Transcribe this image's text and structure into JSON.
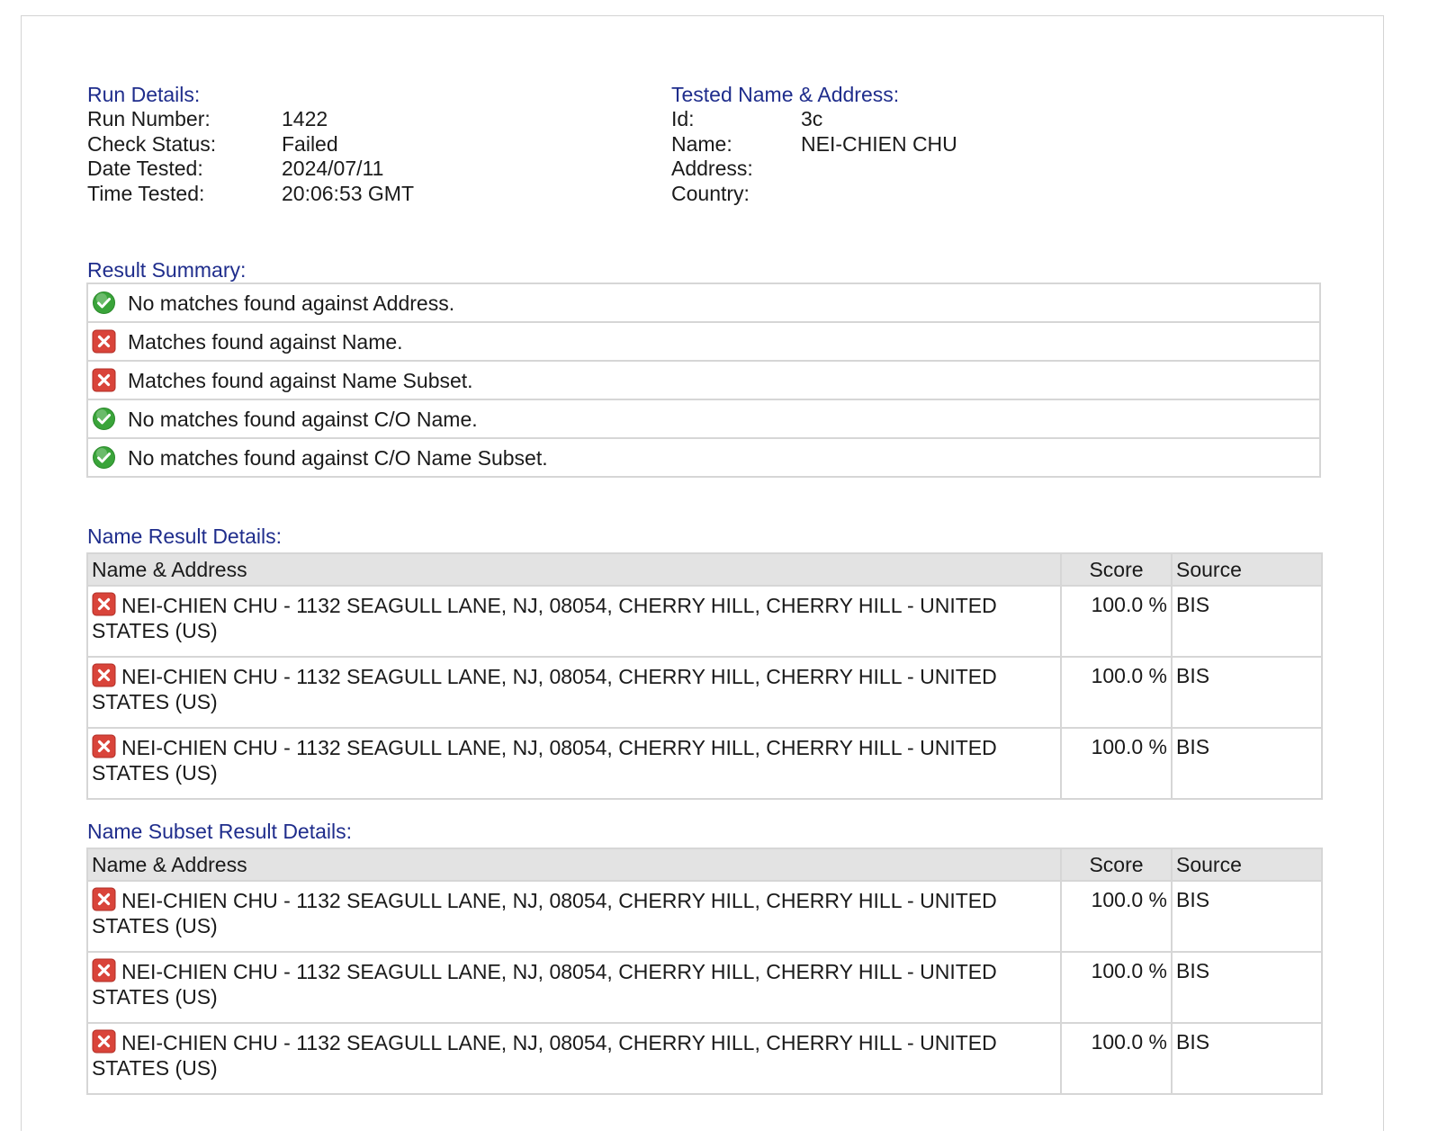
{
  "run_details": {
    "title": "Run Details:",
    "fields": [
      {
        "label": "Run Number:",
        "value": "1422"
      },
      {
        "label": "Check Status:",
        "value": "Failed"
      },
      {
        "label": "Date Tested:",
        "value": "2024/07/11"
      },
      {
        "label": "Time Tested:",
        "value": "20:06:53 GMT"
      }
    ]
  },
  "tested": {
    "title": "Tested Name & Address:",
    "fields": [
      {
        "label": "Id:",
        "value": "3c"
      },
      {
        "label": "Name:",
        "value": "NEI-CHIEN CHU"
      },
      {
        "label": "Address:",
        "value": ""
      },
      {
        "label": "Country:",
        "value": ""
      }
    ]
  },
  "summary": {
    "title": "Result Summary:",
    "rows": [
      {
        "status": "pass",
        "icon": "check-circle-icon",
        "text": "No matches found against Address."
      },
      {
        "status": "fail",
        "icon": "x-square-icon",
        "text": "Matches found against Name."
      },
      {
        "status": "fail",
        "icon": "x-square-icon",
        "text": "Matches found against Name Subset."
      },
      {
        "status": "pass",
        "icon": "check-circle-icon",
        "text": "No matches found against C/O Name."
      },
      {
        "status": "pass",
        "icon": "check-circle-icon",
        "text": "No matches found against C/O Name Subset."
      }
    ]
  },
  "name_results": {
    "title": "Name Result Details:",
    "headers": {
      "name": "Name & Address",
      "score": "Score",
      "source": "Source"
    },
    "rows": [
      {
        "icon": "x-square-icon",
        "name": "NEI-CHIEN CHU - 1132 SEAGULL LANE, NJ, 08054, CHERRY HILL, CHERRY HILL - UNITED STATES (US)",
        "score": "100.0 %",
        "source": "BIS"
      },
      {
        "icon": "x-square-icon",
        "name": "NEI-CHIEN CHU - 1132 SEAGULL LANE, NJ, 08054, CHERRY HILL, CHERRY HILL - UNITED STATES (US)",
        "score": "100.0 %",
        "source": "BIS"
      },
      {
        "icon": "x-square-icon",
        "name": "NEI-CHIEN CHU - 1132 SEAGULL LANE, NJ, 08054, CHERRY HILL, CHERRY HILL - UNITED STATES (US)",
        "score": "100.0 %",
        "source": "BIS"
      }
    ]
  },
  "subset_results": {
    "title": "Name Subset Result Details:",
    "headers": {
      "name": "Name & Address",
      "score": "Score",
      "source": "Source"
    },
    "rows": [
      {
        "icon": "x-square-icon",
        "name": "NEI-CHIEN CHU - 1132 SEAGULL LANE, NJ, 08054, CHERRY HILL, CHERRY HILL - UNITED STATES (US)",
        "score": "100.0 %",
        "source": "BIS"
      },
      {
        "icon": "x-square-icon",
        "name": "NEI-CHIEN CHU - 1132 SEAGULL LANE, NJ, 08054, CHERRY HILL, CHERRY HILL - UNITED STATES (US)",
        "score": "100.0 %",
        "source": "BIS"
      },
      {
        "icon": "x-square-icon",
        "name": "NEI-CHIEN CHU - 1132 SEAGULL LANE, NJ, 08054, CHERRY HILL, CHERRY HILL - UNITED STATES (US)",
        "score": "100.0 %",
        "source": "BIS"
      }
    ]
  },
  "colors": {
    "section_title": "#1f2d8c",
    "pass": "#3aa43a",
    "fail": "#d9443a",
    "header_bg": "#e3e3e3",
    "border": "#d6d6d6"
  }
}
